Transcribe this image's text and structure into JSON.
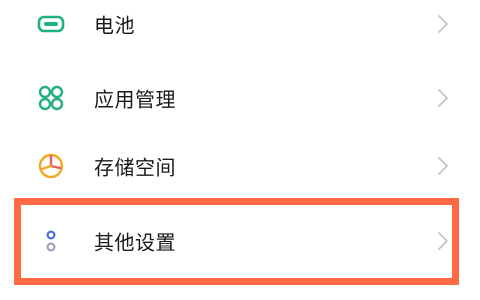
{
  "settings": {
    "items": [
      {
        "label": "电池",
        "icon": "battery-icon",
        "icon_color": "#22b07d"
      },
      {
        "label": "应用管理",
        "icon": "apps-grid-icon",
        "icon_color": "#22b07d"
      },
      {
        "label": "存储空间",
        "icon": "storage-pie-icon",
        "icon_color": "#f5a623"
      },
      {
        "label": "其他设置",
        "icon": "more-settings-icon",
        "icon_color": "#4a6fd6"
      }
    ]
  },
  "colors": {
    "highlight_border": "#ff6a45",
    "chevron": "#c4c4c4",
    "text": "#1a1a1a"
  }
}
